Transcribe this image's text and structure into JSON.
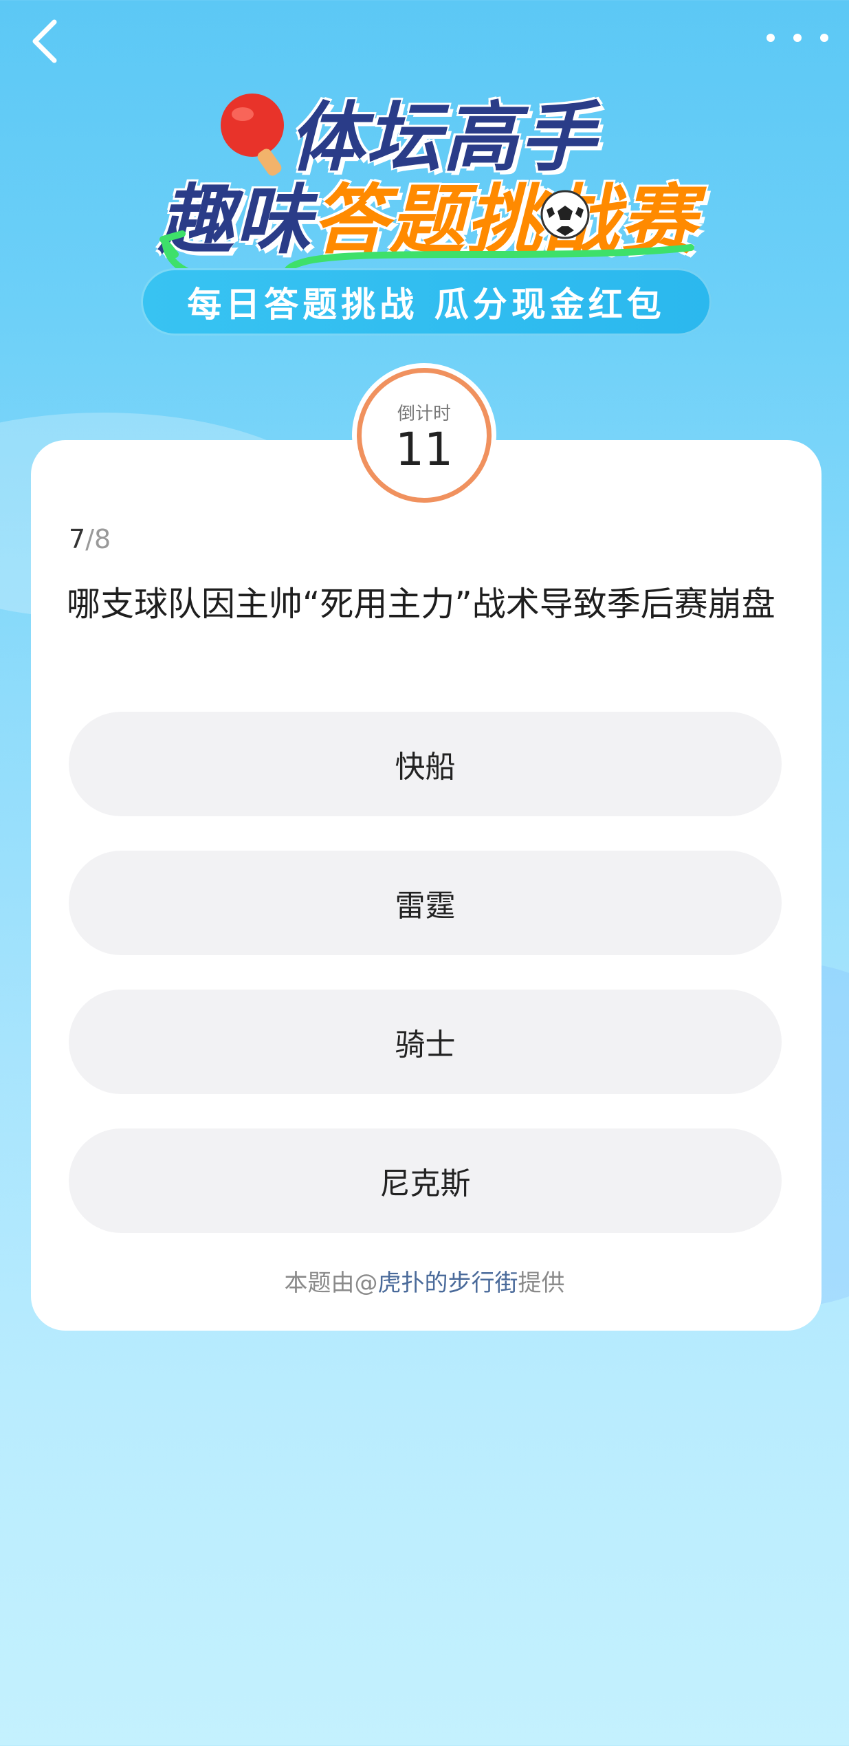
{
  "nav": {
    "back_icon": "chevron-left-icon",
    "more_icon": "more-horizontal-icon"
  },
  "banner": {
    "title_line1": "体坛高手",
    "title_line2_dark": "趣味",
    "title_line2_orange": "答题挑战赛",
    "subtitle": "每日答题挑战  瓜分现金红包"
  },
  "timer": {
    "label": "倒计时",
    "value": "11"
  },
  "progress": {
    "current": "7",
    "separator": "/",
    "total": "8"
  },
  "question": {
    "text": "哪支球队因主帅“死用主力”战术导致季后赛崩盘"
  },
  "options": [
    {
      "label": "快船"
    },
    {
      "label": "雷霆"
    },
    {
      "label": "骑士"
    },
    {
      "label": "尼克斯"
    }
  ],
  "credit": {
    "prefix": "本题由@",
    "author": "虎扑的步行街",
    "suffix": "提供"
  },
  "colors": {
    "background_top": "#5cc8f5",
    "background_bottom": "#c4f1fe",
    "title_dark": "#2a3c88",
    "title_orange": "#ff8a00",
    "timer_ring": "#f0915e",
    "option_bg": "#f2f2f4",
    "author_link": "#4a6a9a"
  }
}
